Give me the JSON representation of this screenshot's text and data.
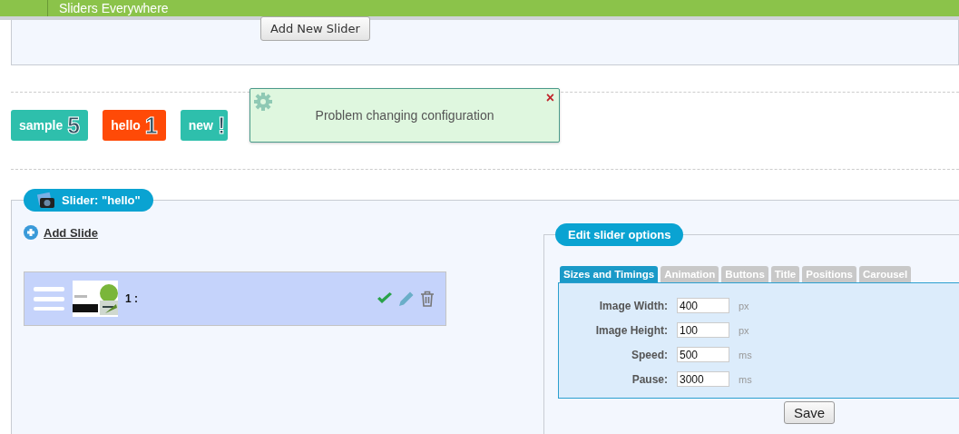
{
  "header": {
    "title": "Sliders Everywhere"
  },
  "add_slider_button": "Add New Slider",
  "sliders": [
    {
      "name": "sample",
      "count": "5",
      "color": "#2ebfac"
    },
    {
      "name": "hello",
      "count": "1",
      "color": "#ff4a07"
    },
    {
      "name": "new",
      "count": "!",
      "color": "#2ebfac"
    }
  ],
  "notification": {
    "message": "Problem changing configuration",
    "close": "×"
  },
  "slider_panel": {
    "title": "Slider: \"hello\"",
    "add_slide": "Add Slide",
    "slides": [
      {
        "kind": "picture",
        "label": "1 :",
        "active": true
      }
    ]
  },
  "options_panel": {
    "title": "Edit slider options",
    "tabs": [
      {
        "label": "Sizes and Timings",
        "selected": true
      },
      {
        "label": "Animation",
        "selected": false
      },
      {
        "label": "Buttons",
        "selected": false
      },
      {
        "label": "Title",
        "selected": false
      },
      {
        "label": "Positions",
        "selected": false
      },
      {
        "label": "Carousel",
        "selected": false
      }
    ],
    "fields": [
      {
        "label": "Image Width:",
        "value": "400",
        "unit": "px"
      },
      {
        "label": "Image Height:",
        "value": "100",
        "unit": "px"
      },
      {
        "label": "Speed:",
        "value": "500",
        "unit": "ms"
      },
      {
        "label": "Pause:",
        "value": "3000",
        "unit": "ms"
      }
    ],
    "save_button": "Save"
  }
}
